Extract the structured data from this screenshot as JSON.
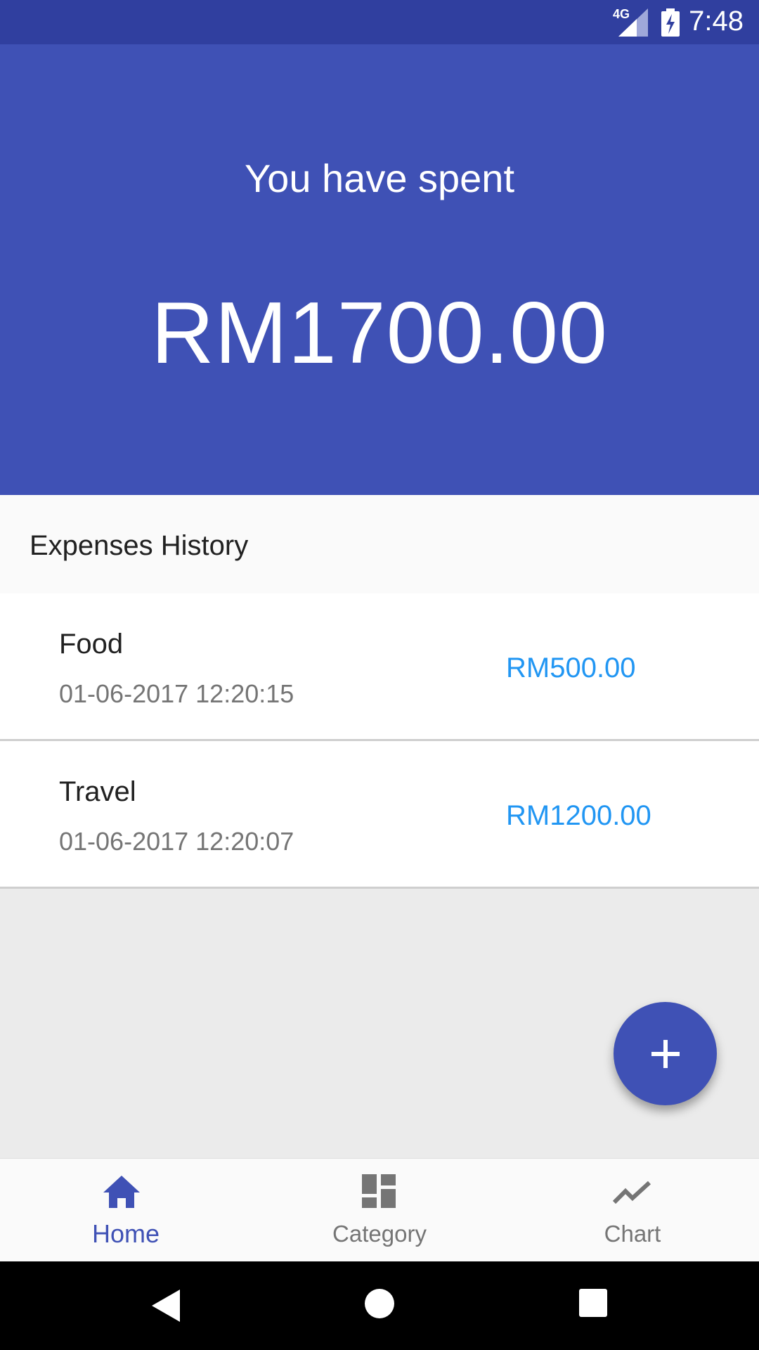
{
  "status_bar": {
    "time": "7:48",
    "network": "4G"
  },
  "header": {
    "subtitle": "You have spent",
    "amount": "RM1700.00"
  },
  "section": {
    "title": "Expenses History"
  },
  "expenses": [
    {
      "name": "Food",
      "date": "01-06-2017 12:20:15",
      "amount": "RM500.00"
    },
    {
      "name": "Travel",
      "date": "01-06-2017 12:20:07",
      "amount": "RM1200.00"
    }
  ],
  "fab": {
    "icon": "plus-icon"
  },
  "bottom_nav": {
    "items": [
      {
        "label": "Home",
        "icon": "home-icon",
        "active": true
      },
      {
        "label": "Category",
        "icon": "dashboard-icon",
        "active": false
      },
      {
        "label": "Chart",
        "icon": "chart-line-icon",
        "active": false
      }
    ]
  },
  "colors": {
    "primary": "#3f51b5",
    "primary_dark": "#303f9f",
    "accent_amount": "#2196f3"
  },
  "system_nav": {
    "icons": [
      "back-icon",
      "home-circle-icon",
      "recents-icon"
    ]
  }
}
